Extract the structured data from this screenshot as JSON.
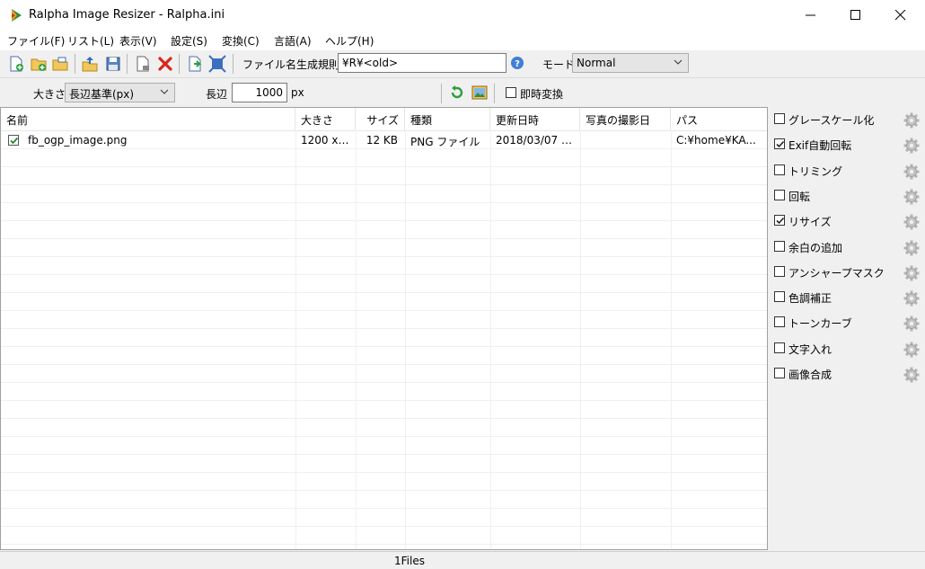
{
  "window": {
    "title": "Ralpha Image Resizer - Ralpha.ini"
  },
  "menu": [
    "ファイル(F)",
    "リスト(L)",
    "表示(V)",
    "設定(S)",
    "変換(C)",
    "言語(A)",
    "ヘルプ(H)"
  ],
  "toolbar": {
    "filename_rule_label": "ファイル名生成規則",
    "filename_rule_value": "¥R¥<old>",
    "mode_label": "モード",
    "mode_value": "Normal"
  },
  "toolbar2": {
    "size_label": "大きさ",
    "size_value": "長辺基準(px)",
    "long_side_label": "長辺",
    "long_side_value": "1000",
    "unit": "px",
    "instant_convert_label": "即時変換",
    "instant_convert_checked": false
  },
  "list": {
    "columns": [
      "名前",
      "大きさ",
      "サイズ",
      "種類",
      "更新日時",
      "写真の撮影日",
      "パス"
    ],
    "rows": [
      {
        "checked": true,
        "name": "fb_ogp_image.png",
        "dimensions": "1200 x ...",
        "size": "12 KB",
        "type": "PNG ファイル",
        "modified": "2018/03/07 1...",
        "taken": "",
        "path": "C:¥home¥KA..."
      }
    ]
  },
  "effects": [
    {
      "label": "グレースケール化",
      "checked": false
    },
    {
      "label": "Exif自動回転",
      "checked": true
    },
    {
      "label": "トリミング",
      "checked": false
    },
    {
      "label": "回転",
      "checked": false
    },
    {
      "label": "リサイズ",
      "checked": true
    },
    {
      "label": "余白の追加",
      "checked": false
    },
    {
      "label": "アンシャープマスク",
      "checked": false
    },
    {
      "label": "色調補正",
      "checked": false
    },
    {
      "label": "トーンカーブ",
      "checked": false
    },
    {
      "label": "文字入れ",
      "checked": false
    },
    {
      "label": "画像合成",
      "checked": false
    }
  ],
  "status": {
    "text": "1Files"
  }
}
